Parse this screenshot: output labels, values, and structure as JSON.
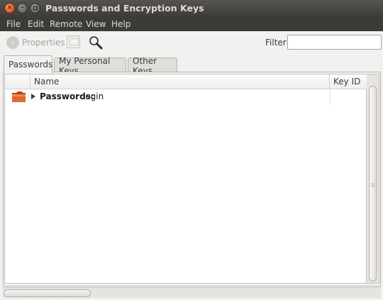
{
  "window": {
    "title": "Passwords and Encryption Keys",
    "buttons": {
      "close": "×",
      "minimize": "–",
      "maximize": ""
    }
  },
  "menubar": {
    "items": [
      "File",
      "Edit",
      "Remote",
      "View",
      "Help"
    ]
  },
  "toolbar": {
    "properties_label": "Properties",
    "properties_icon": "properties-icon",
    "export_icon": "export-icon",
    "search_icon": "search-icon",
    "filter_label": "Filter:",
    "filter_value": "",
    "filter_placeholder": ""
  },
  "tabs": [
    {
      "label": "Passwords",
      "active": true
    },
    {
      "label": "My Personal Keys",
      "active": false
    },
    {
      "label": "Other Keys",
      "active": false
    }
  ],
  "table": {
    "columns": [
      "Name",
      "Key ID"
    ],
    "rows": [
      {
        "icon": "folder-icon",
        "name_bold": "Passwords:",
        "name_rest": "login",
        "key_id": "",
        "expanded": false
      }
    ]
  },
  "colors": {
    "titlebar": "#3c3b37",
    "close_button": "#e15a24",
    "window_bg": "#f2f1f0",
    "folder": "#d35a1c"
  }
}
